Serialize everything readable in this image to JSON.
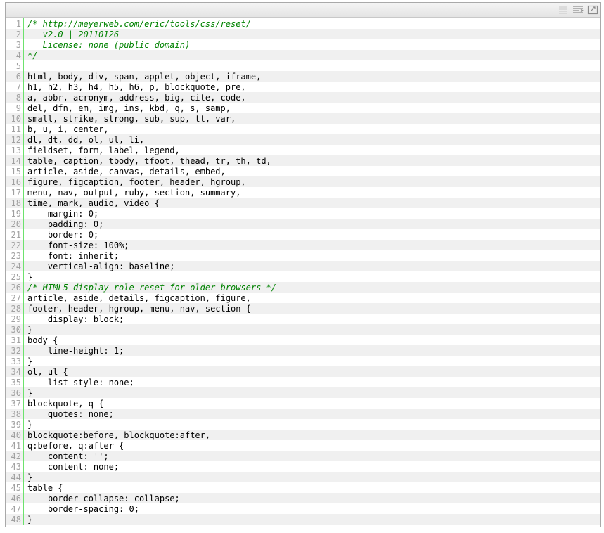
{
  "toolbar": {
    "icons": [
      "view-source-icon",
      "copy-to-clipboard-icon",
      "print-icon"
    ]
  },
  "code": {
    "language": "css",
    "lines": [
      {
        "n": "1",
        "text": "/* http://meyerweb.com/eric/tools/css/reset/",
        "kind": "comment"
      },
      {
        "n": "2",
        "text": "   v2.0 | 20110126",
        "kind": "comment"
      },
      {
        "n": "3",
        "text": "   License: none (public domain)",
        "kind": "comment"
      },
      {
        "n": "4",
        "text": "*/",
        "kind": "comment"
      },
      {
        "n": "5",
        "text": "",
        "kind": "code"
      },
      {
        "n": "6",
        "text": "html, body, div, span, applet, object, iframe,",
        "kind": "code"
      },
      {
        "n": "7",
        "text": "h1, h2, h3, h4, h5, h6, p, blockquote, pre,",
        "kind": "code"
      },
      {
        "n": "8",
        "text": "a, abbr, acronym, address, big, cite, code,",
        "kind": "code"
      },
      {
        "n": "9",
        "text": "del, dfn, em, img, ins, kbd, q, s, samp,",
        "kind": "code"
      },
      {
        "n": "10",
        "text": "small, strike, strong, sub, sup, tt, var,",
        "kind": "code"
      },
      {
        "n": "11",
        "text": "b, u, i, center,",
        "kind": "code"
      },
      {
        "n": "12",
        "text": "dl, dt, dd, ol, ul, li,",
        "kind": "code"
      },
      {
        "n": "13",
        "text": "fieldset, form, label, legend,",
        "kind": "code"
      },
      {
        "n": "14",
        "text": "table, caption, tbody, tfoot, thead, tr, th, td,",
        "kind": "code"
      },
      {
        "n": "15",
        "text": "article, aside, canvas, details, embed,",
        "kind": "code"
      },
      {
        "n": "16",
        "text": "figure, figcaption, footer, header, hgroup,",
        "kind": "code"
      },
      {
        "n": "17",
        "text": "menu, nav, output, ruby, section, summary,",
        "kind": "code"
      },
      {
        "n": "18",
        "text": "time, mark, audio, video {",
        "kind": "code"
      },
      {
        "n": "19",
        "text": "    margin: 0;",
        "kind": "code"
      },
      {
        "n": "20",
        "text": "    padding: 0;",
        "kind": "code"
      },
      {
        "n": "21",
        "text": "    border: 0;",
        "kind": "code"
      },
      {
        "n": "22",
        "text": "    font-size: 100%;",
        "kind": "code"
      },
      {
        "n": "23",
        "text": "    font: inherit;",
        "kind": "code"
      },
      {
        "n": "24",
        "text": "    vertical-align: baseline;",
        "kind": "code"
      },
      {
        "n": "25",
        "text": "}",
        "kind": "code"
      },
      {
        "n": "26",
        "text": "/* HTML5 display-role reset for older browsers */",
        "kind": "comment"
      },
      {
        "n": "27",
        "text": "article, aside, details, figcaption, figure,",
        "kind": "code"
      },
      {
        "n": "28",
        "text": "footer, header, hgroup, menu, nav, section {",
        "kind": "code"
      },
      {
        "n": "29",
        "text": "    display: block;",
        "kind": "code"
      },
      {
        "n": "30",
        "text": "}",
        "kind": "code"
      },
      {
        "n": "31",
        "text": "body {",
        "kind": "code"
      },
      {
        "n": "32",
        "text": "    line-height: 1;",
        "kind": "code"
      },
      {
        "n": "33",
        "text": "}",
        "kind": "code"
      },
      {
        "n": "34",
        "text": "ol, ul {",
        "kind": "code"
      },
      {
        "n": "35",
        "text": "    list-style: none;",
        "kind": "code"
      },
      {
        "n": "36",
        "text": "}",
        "kind": "code"
      },
      {
        "n": "37",
        "text": "blockquote, q {",
        "kind": "code"
      },
      {
        "n": "38",
        "text": "    quotes: none;",
        "kind": "code"
      },
      {
        "n": "39",
        "text": "}",
        "kind": "code"
      },
      {
        "n": "40",
        "text": "blockquote:before, blockquote:after,",
        "kind": "code"
      },
      {
        "n": "41",
        "text": "q:before, q:after {",
        "kind": "code"
      },
      {
        "n": "42",
        "text": "    content: '';",
        "kind": "code"
      },
      {
        "n": "43",
        "text": "    content: none;",
        "kind": "code"
      },
      {
        "n": "44",
        "text": "}",
        "kind": "code"
      },
      {
        "n": "45",
        "text": "table {",
        "kind": "code"
      },
      {
        "n": "46",
        "text": "    border-collapse: collapse;",
        "kind": "code"
      },
      {
        "n": "47",
        "text": "    border-spacing: 0;",
        "kind": "code"
      },
      {
        "n": "48",
        "text": "}",
        "kind": "code"
      }
    ]
  },
  "colors": {
    "comment": "#008200",
    "line_number": "#a0a0a0",
    "gutter_line": "#6ce26c",
    "alt_row": "#f0f0f0",
    "border": "#a9a9a9"
  }
}
